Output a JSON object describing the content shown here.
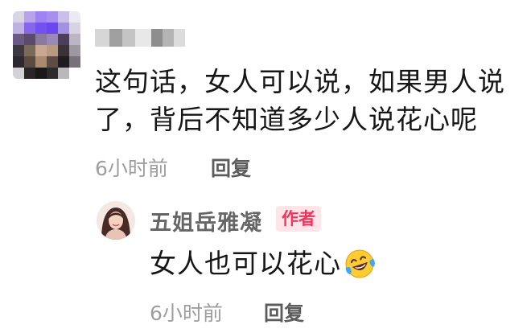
{
  "comment": {
    "text_line1": "这句话，女人可以说，如果男人说",
    "text_line2": "了，背后不知道多少人说花心呢",
    "time": "6小时前",
    "reply_label": "回复"
  },
  "reply": {
    "author_name": "五姐岳雅凝",
    "author_badge": "作者",
    "text": "女人也可以花心",
    "emoji_icon": "laughing-tears-icon",
    "time": "6小时前",
    "reply_label": "回复"
  },
  "colors": {
    "badge_bg": "#ffe4ea",
    "badge_text": "#f0345c",
    "meta_text": "#9e9e9e"
  }
}
